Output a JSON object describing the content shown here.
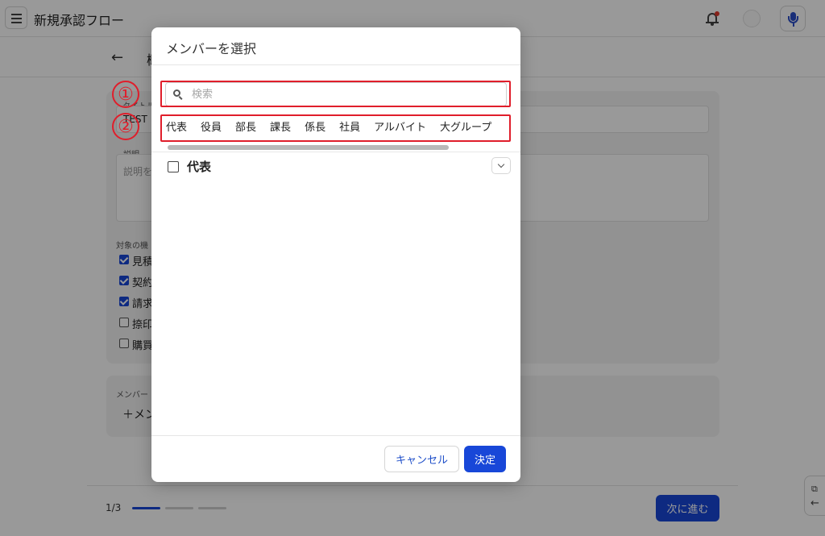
{
  "app": {
    "title": "新規承認フロー"
  },
  "subheader": {
    "title": "概"
  },
  "form": {
    "title_label": "タイトル",
    "title_value": "TEST",
    "desc_label": "説明",
    "desc_placeholder": "説明を",
    "target_label": "対象の機",
    "checkboxes": [
      {
        "label": "見積",
        "checked": true
      },
      {
        "label": "契約",
        "checked": true
      },
      {
        "label": "請求",
        "checked": true
      },
      {
        "label": "捺印",
        "checked": false
      },
      {
        "label": "購買",
        "checked": false
      }
    ],
    "member_label": "メンバー",
    "add_member_label": "＋メン"
  },
  "footer": {
    "page": "1/3",
    "next_label": "次に進む"
  },
  "side_tool": {
    "external": "⧉",
    "back": "←"
  },
  "dialog": {
    "title": "メンバーを選択",
    "search_placeholder": "検索",
    "tabs": [
      "代表",
      "役員",
      "部長",
      "課長",
      "係長",
      "社員",
      "アルバイト",
      "大グループ"
    ],
    "group": {
      "label": "代表",
      "checked": false
    },
    "cancel_label": "キャンセル",
    "ok_label": "決定"
  },
  "annotations": {
    "marker1": "①",
    "marker2": "②"
  },
  "colors": {
    "primary": "#1847d8",
    "highlight": "#e01e2b",
    "notification": "#e23a2c"
  }
}
